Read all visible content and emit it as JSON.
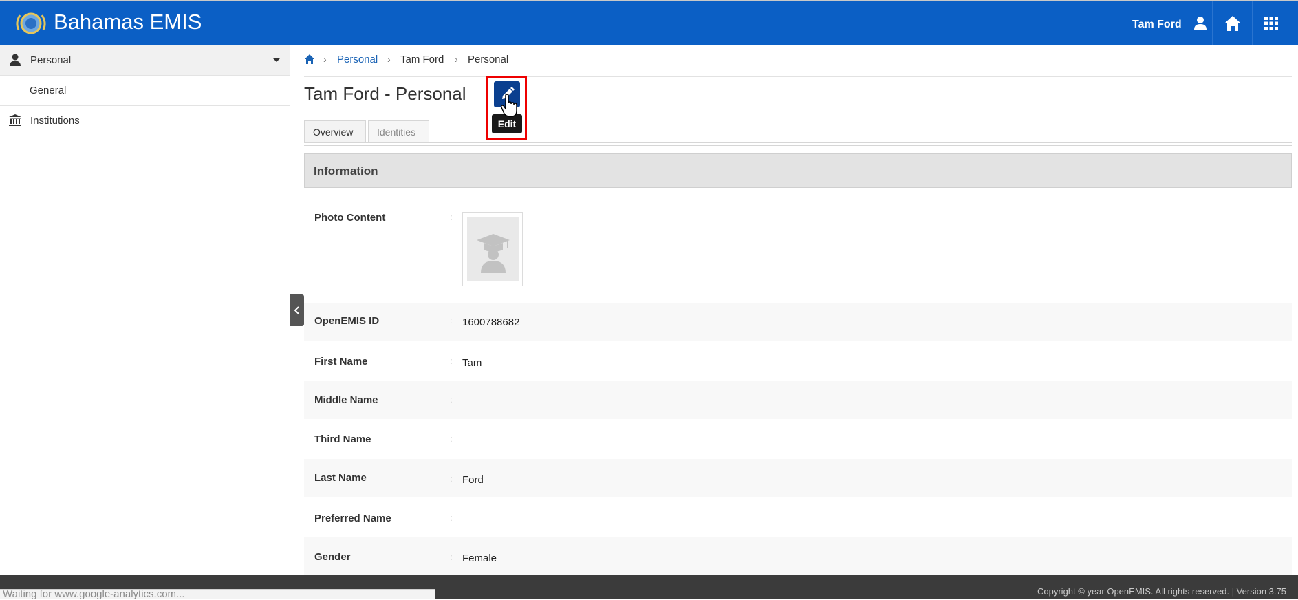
{
  "header": {
    "brand": "Bahamas EMIS",
    "user_name": "Tam Ford",
    "icons": {
      "logo": "emis-logo",
      "user": "user-icon",
      "home": "home-icon",
      "apps": "apps-grid-icon"
    }
  },
  "sidebar": {
    "items": [
      {
        "label": "Personal",
        "icon": "user-icon",
        "expanded": true
      },
      {
        "label": "General"
      },
      {
        "label": "Institutions",
        "icon": "institution-icon"
      }
    ]
  },
  "breadcrumb": {
    "items": [
      "Personal",
      "Tam Ford",
      "Personal"
    ],
    "separator": "›"
  },
  "page": {
    "title": "Tam Ford - Personal",
    "edit_tooltip": "Edit"
  },
  "tabs": [
    {
      "label": "Overview",
      "active": true
    },
    {
      "label": "Identities",
      "active": false
    }
  ],
  "section": {
    "title": "Information",
    "photo_label": "Photo Content",
    "fields": [
      {
        "label": "OpenEMIS ID",
        "value": "1600788682"
      },
      {
        "label": "First Name",
        "value": "Tam"
      },
      {
        "label": "Middle Name",
        "value": ""
      },
      {
        "label": "Third Name",
        "value": ""
      },
      {
        "label": "Last Name",
        "value": "Ford"
      },
      {
        "label": "Preferred Name",
        "value": ""
      },
      {
        "label": "Gender",
        "value": "Female"
      }
    ],
    "colon": ":"
  },
  "footer": {
    "status": "Waiting for www.google-analytics.com...",
    "copyright": "Copyright © year OpenEMIS. All rights reserved. | Version 3.75"
  },
  "colors": {
    "header_bg": "#0b5fc5",
    "edit_button": "#0a3f8f",
    "highlight": "#ee0000",
    "link": "#1a63b5"
  }
}
